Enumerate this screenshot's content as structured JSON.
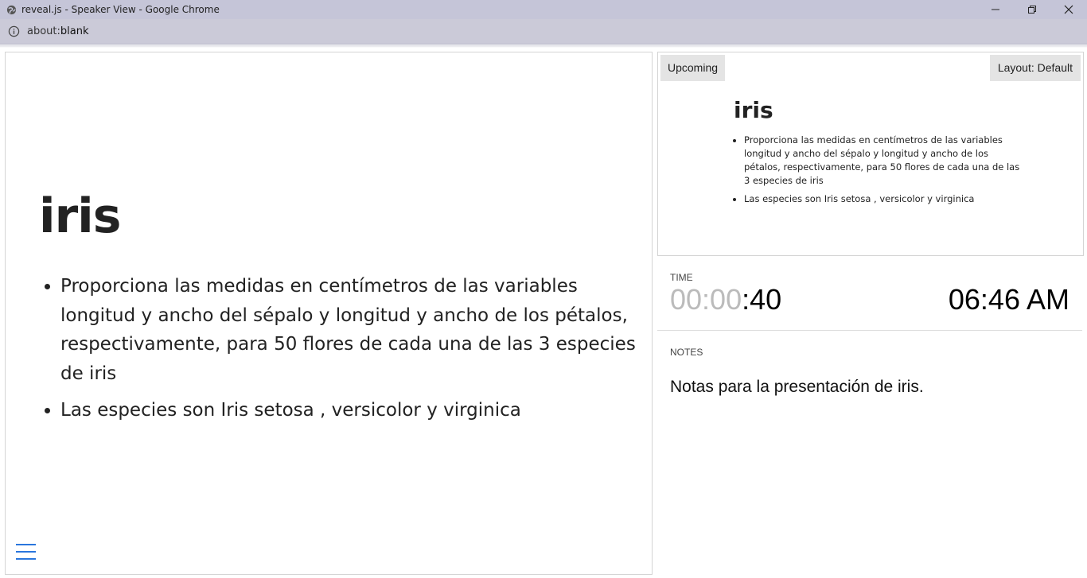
{
  "window": {
    "title": "reveal.js - Speaker View - Google Chrome",
    "url_host": "about:",
    "url_path": "blank"
  },
  "current_slide": {
    "title": "iris",
    "bullets": [
      "Proporciona las medidas en centímetros de las variables longitud y ancho del sépalo y longitud y ancho de los pétalos, respectivamente, para 50 flores de cada una de las 3 especies de iris",
      "Las especies son Iris setosa , versicolor y virginica"
    ]
  },
  "upcoming": {
    "label": "Upcoming",
    "layout_button": "Layout: Default",
    "title": "iris",
    "bullets": [
      "Proporciona las medidas en centímetros de las variables longitud y ancho del sépalo y longitud y ancho de los pétalos, respectivamente, para 50 flores de cada una de las 3 especies de iris",
      "Las especies son Iris setosa , versicolor y virginica"
    ]
  },
  "time": {
    "label": "TIME",
    "timer_dim": "00:00",
    "timer_active": ":40",
    "clock": "06:46 AM"
  },
  "notes": {
    "label": "NOTES",
    "text": "Notas para la presentación de iris."
  },
  "icons": {
    "favicon": "globe-icon",
    "info": "info-icon",
    "menu": "hamburger-menu-icon"
  },
  "colors": {
    "titlebar": "#c5c5d8",
    "menu_accent": "#2a76dd"
  }
}
